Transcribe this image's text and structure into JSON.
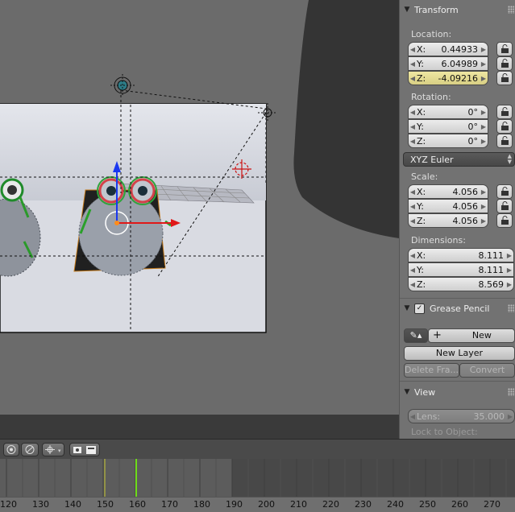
{
  "transform": {
    "header": "Transform",
    "location_label": "Location:",
    "location": [
      {
        "axis": "X:",
        "value": "0.44933"
      },
      {
        "axis": "Y:",
        "value": "6.04989"
      },
      {
        "axis": "Z:",
        "value": "-4.09216"
      }
    ],
    "rotation_label": "Rotation:",
    "rotation": [
      {
        "axis": "X:",
        "value": "0°"
      },
      {
        "axis": "Y:",
        "value": "0°"
      },
      {
        "axis": "Z:",
        "value": "0°"
      }
    ],
    "rotation_mode": "XYZ Euler",
    "scale_label": "Scale:",
    "scale": [
      {
        "axis": "X:",
        "value": "4.056"
      },
      {
        "axis": "Y:",
        "value": "4.056"
      },
      {
        "axis": "Z:",
        "value": "4.056"
      }
    ],
    "dimensions_label": "Dimensions:",
    "dimensions": [
      {
        "axis": "X:",
        "value": "8.111"
      },
      {
        "axis": "Y:",
        "value": "8.111"
      },
      {
        "axis": "Z:",
        "value": "8.569"
      }
    ]
  },
  "grease_pencil": {
    "header": "Grease Pencil",
    "new_label": "New",
    "new_layer_label": "New Layer",
    "delete_frame_label": "Delete Fra...",
    "convert_label": "Convert"
  },
  "view": {
    "header": "View",
    "lens_label": "Lens:",
    "lens_value": "35.000",
    "lock_to_object_label": "Lock to Object:"
  },
  "timeline": {
    "ticks": [
      "120",
      "130",
      "140",
      "150",
      "160",
      "170",
      "180",
      "190",
      "200",
      "210",
      "220",
      "230",
      "240",
      "250",
      "260",
      "270"
    ],
    "current_frame": 160,
    "marker_frame": 150,
    "range_end": 190
  },
  "colors": {
    "highlight_field": "#e0d78f",
    "playhead": "#6fdc1a",
    "accent_axis_x": "#ff2020",
    "accent_axis_z": "#1d3fff"
  }
}
